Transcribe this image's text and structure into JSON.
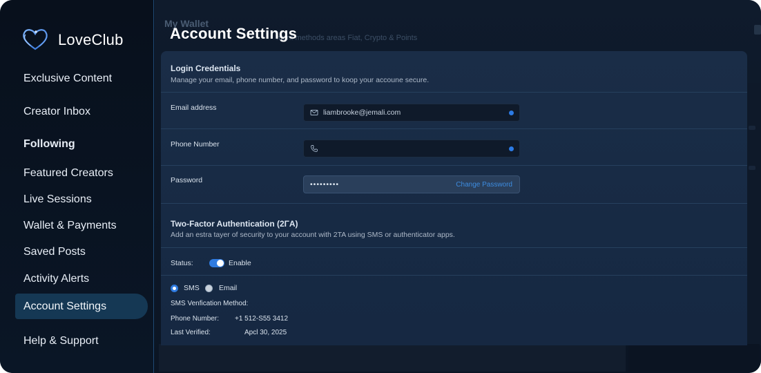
{
  "brand": {
    "name": "LoveClub"
  },
  "sidebar": {
    "items": [
      {
        "label": "Exclusive Content"
      },
      {
        "label": "Creator Inbox"
      },
      {
        "label": "Following"
      },
      {
        "label": "Featured Creators"
      },
      {
        "label": "Live Sessions"
      },
      {
        "label": "Wallet & Payments"
      },
      {
        "label": "Saved Posts"
      },
      {
        "label": "Activity Alerts"
      },
      {
        "label": "Account Settings"
      },
      {
        "label": "Help & Support"
      }
    ],
    "active_item": "Account Settings"
  },
  "background_page": {
    "title": "My Wallet",
    "subtitle": "ment methods areas Fiat, Crypto & Points"
  },
  "page": {
    "title": "Account Settings"
  },
  "login": {
    "title": "Login Credentials",
    "description": "Manage your email, phone number, and password to koop your accoune secure.",
    "email": {
      "label": "Email address",
      "value": "liambrooke@jemali.com",
      "icon": "envelope-icon"
    },
    "phone": {
      "label": "Phone Number",
      "value": "",
      "icon": "phone-icon"
    },
    "password": {
      "label": "Password",
      "value": "•••••••••",
      "action": "Change Password"
    }
  },
  "twofa": {
    "title": "Two-Factor Authentication (2ΓA)",
    "description": "Add an estra tayer of security to your account with 2TA using SMS or authenticator apps.",
    "status_label": "Status:",
    "status_value": "Enable",
    "enabled": true,
    "methods": [
      {
        "label": "SMS",
        "selected": true
      },
      {
        "label": "Email",
        "selected": false
      }
    ],
    "sms_method_label": "SMS Venfication Method:",
    "phone_label": "Phone Number:",
    "phone_value": "+1 512-S55 3412",
    "last_verified_label": "Last Verified:",
    "last_verified_value": "Apcl 30, 2025"
  },
  "colors": {
    "accent": "#2f7be0",
    "sidebar_bg": "#08101c",
    "card_bg": "#1a2d47",
    "active_nav_bg": "#153854"
  }
}
